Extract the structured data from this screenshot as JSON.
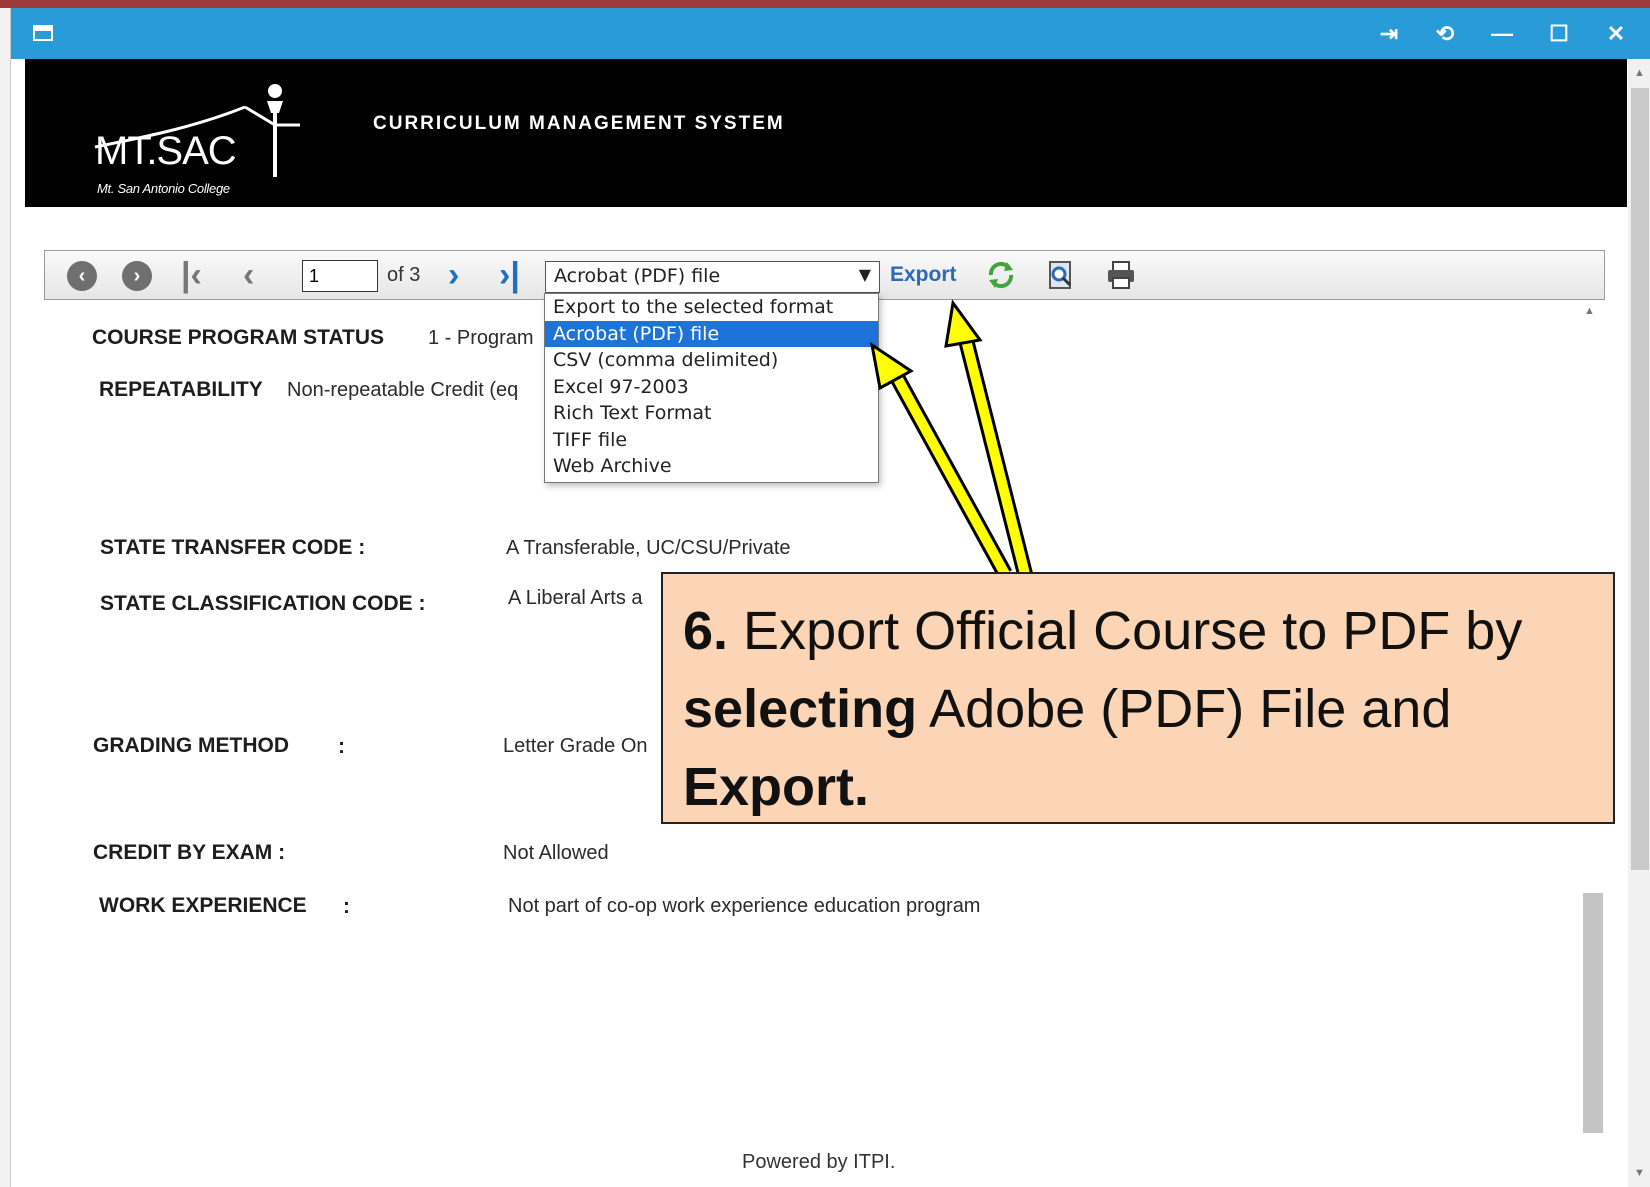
{
  "window": {
    "title_icon": "window-icon",
    "controls": [
      "pin-icon",
      "refresh-icon",
      "minimize-icon",
      "maximize-icon",
      "close-icon"
    ]
  },
  "header": {
    "logo_main": "MT.SAC",
    "logo_sub": "Mt. San Antonio College",
    "system_title": "CURRICULUM MANAGEMENT SYSTEM"
  },
  "toolbar": {
    "page_value": "1",
    "page_of": "of 3",
    "selected_format": "Acrobat (PDF) file",
    "export_label": "Export"
  },
  "dropdown": {
    "options": [
      "Export to the selected format",
      "Acrobat (PDF) file",
      "CSV (comma delimited)",
      "Excel 97-2003",
      "Rich Text Format",
      "TIFF file",
      "Web Archive"
    ],
    "selected_index": 1
  },
  "report": {
    "course_program_status": {
      "label": "COURSE PROGRAM STATUS",
      "value": "1 - Program"
    },
    "repeatability": {
      "label": "REPEATABILITY",
      "value": "Non-repeatable Credit (eq"
    },
    "state_transfer_code": {
      "label": "STATE TRANSFER CODE :",
      "value": "A Transferable, UC/CSU/Private"
    },
    "state_classification_code": {
      "label": "STATE CLASSIFICATION CODE :",
      "value": "A Liberal Arts a"
    },
    "grading_method": {
      "label": "GRADING METHOD",
      "colon": ":",
      "value": "Letter Grade On"
    },
    "credit_by_exam": {
      "label": "CREDIT BY EXAM :",
      "value": "Not Allowed"
    },
    "work_experience": {
      "label": "WORK EXPERIENCE",
      "colon": ":",
      "value": "Not part of co-op work experience education program"
    },
    "footer": "Powered by ITPI."
  },
  "callout": {
    "step": "6.",
    "text1": " Export Official Course to PDF by ",
    "bold1": "selecting",
    "text2": " Adobe (PDF) File and ",
    "bold2": "Export."
  },
  "colors": {
    "titlebar": "#2a9bd9",
    "header_bg": "#000000",
    "callout_bg": "#fbd5b5",
    "arrow": "#ffff00",
    "selected_option": "#1e73d8",
    "export_link": "#2b6ab8"
  }
}
